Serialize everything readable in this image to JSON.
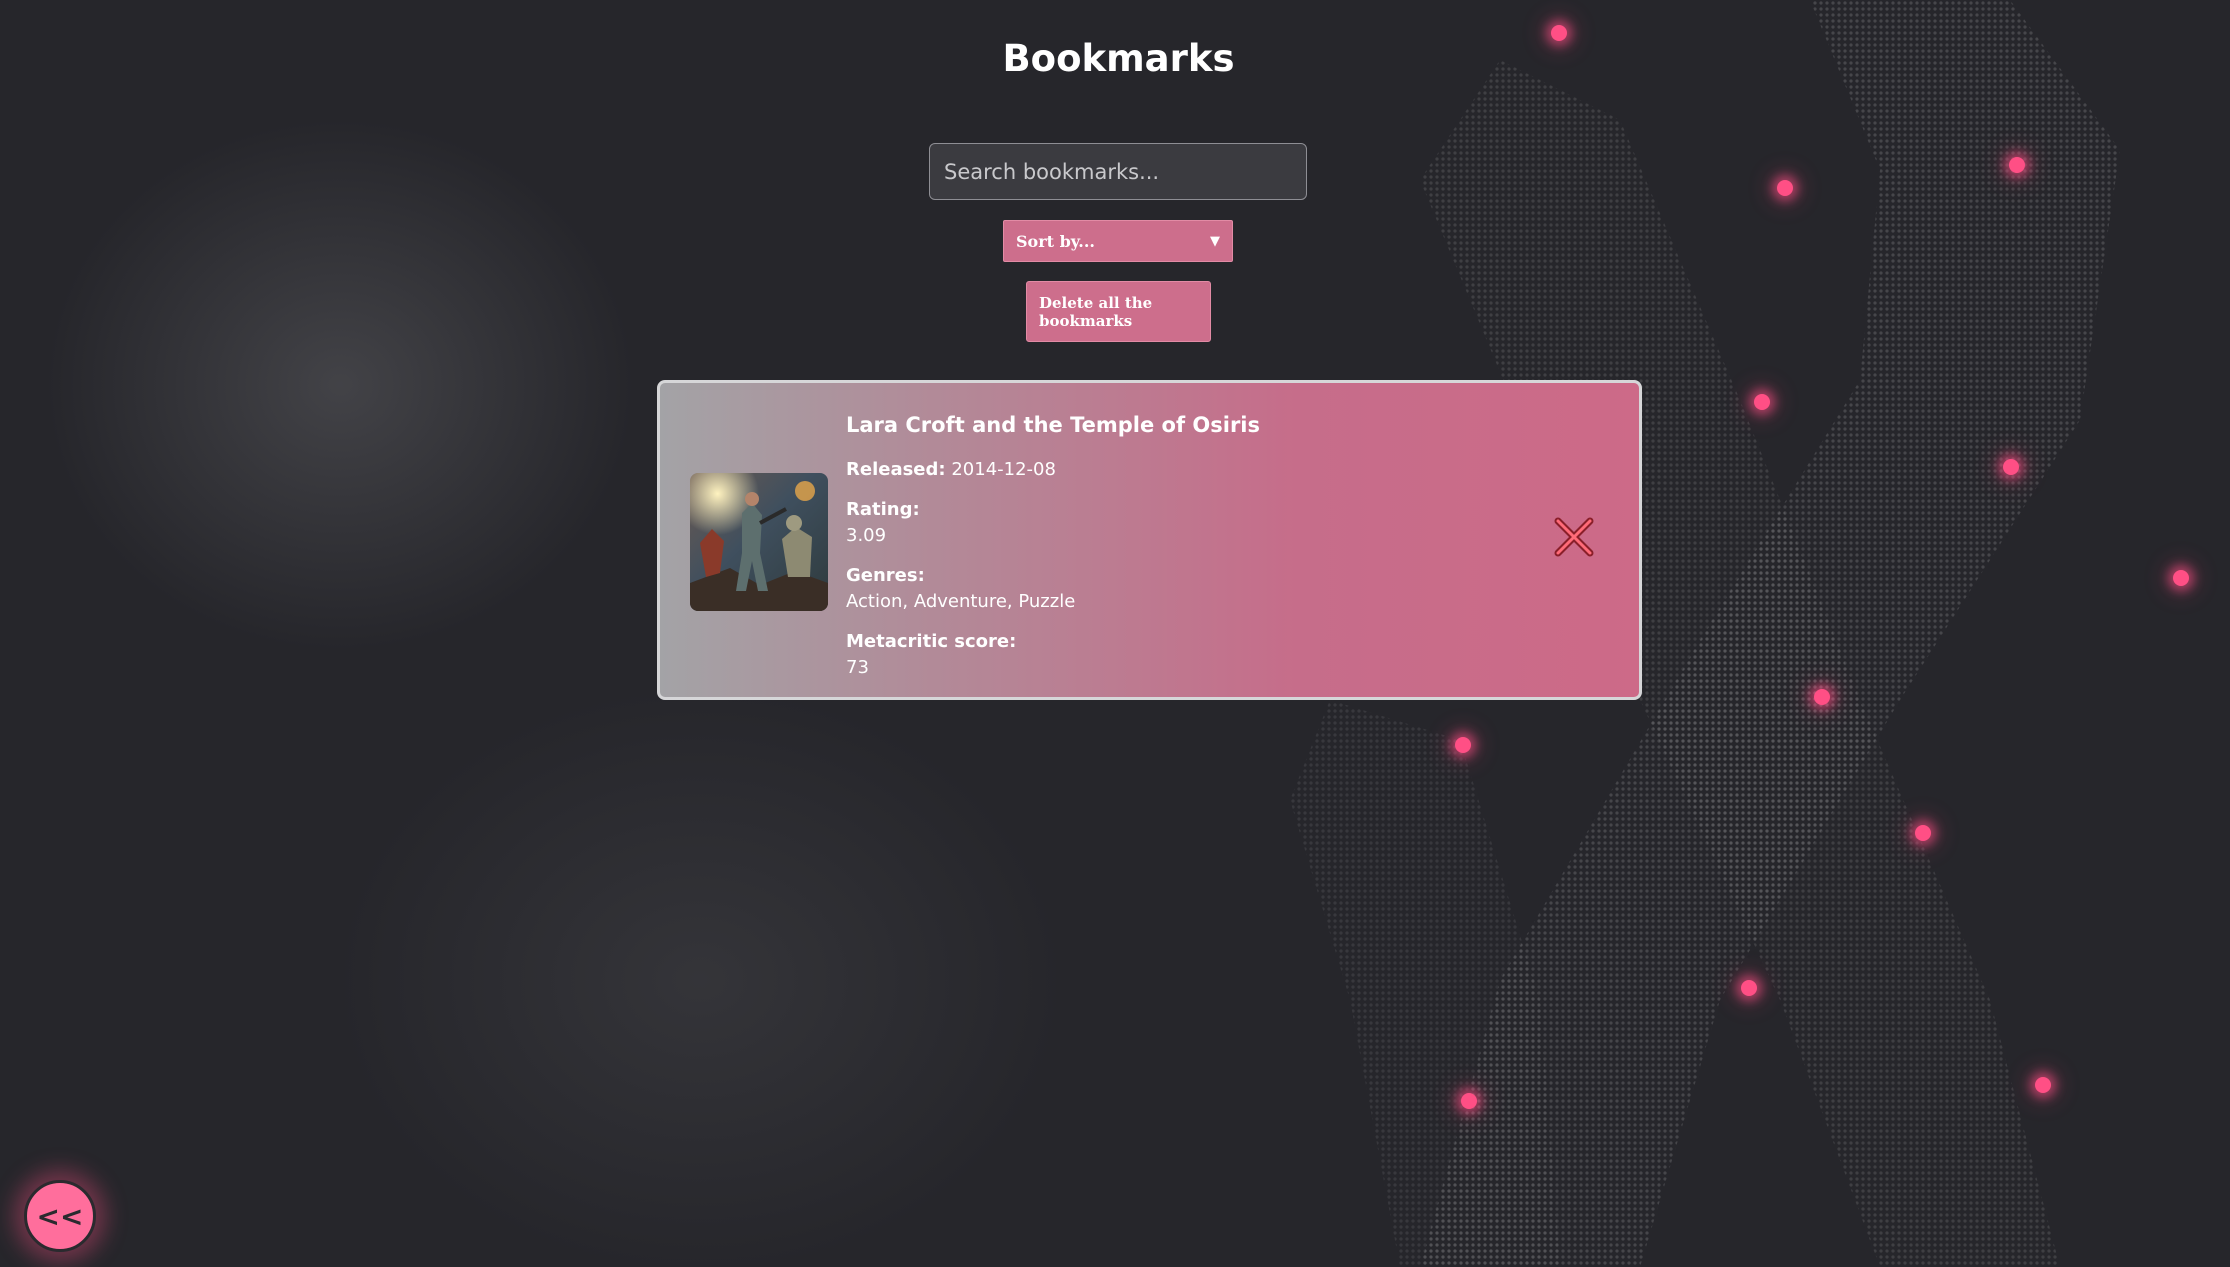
{
  "page": {
    "title": "Bookmarks"
  },
  "search": {
    "placeholder": "Search bookmarks...",
    "value": ""
  },
  "sort": {
    "selected": "Sort by..."
  },
  "actions": {
    "delete_all_label": "Delete all the bookmarks",
    "back_label": "<<"
  },
  "bookmarks": [
    {
      "title": "Lara Croft and the Temple of Osiris",
      "released_label": "Released:",
      "released": "2014-12-08",
      "rating_label": "Rating:",
      "rating": "3.09",
      "genres_label": "Genres:",
      "genres": "Action, Adventure, Puzzle",
      "metacritic_label": "Metacritic score:",
      "metacritic": "73",
      "remove_icon": "close-icon"
    }
  ],
  "colors": {
    "accent": "#cd6e8c",
    "glow_dot": "#ff4f85",
    "background": "#26262b",
    "remove_x": "#e5333f"
  }
}
